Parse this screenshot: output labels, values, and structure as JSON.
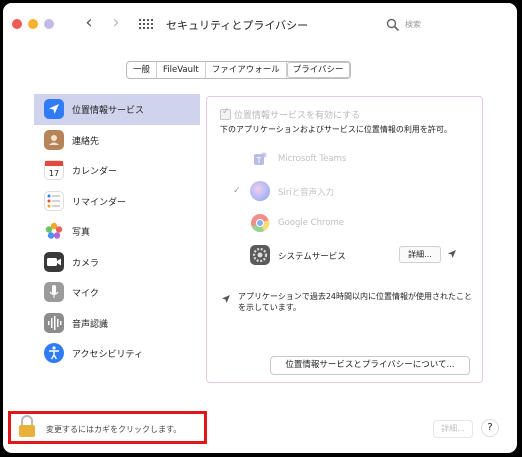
{
  "window": {
    "title": "セキュリティとプライバシー"
  },
  "search": {
    "placeholder": "検索"
  },
  "tabs": [
    "一般",
    "FileVault",
    "ファイアウォール",
    "プライバシー"
  ],
  "sidebar": {
    "items": [
      {
        "label": "位置情報サービス",
        "icon": "location-arrow-icon"
      },
      {
        "label": "連絡先",
        "icon": "contacts-book-icon"
      },
      {
        "label": "カレンダー",
        "icon": "calendar-icon",
        "badge": "17"
      },
      {
        "label": "リマインダー",
        "icon": "reminders-list-icon"
      },
      {
        "label": "写真",
        "icon": "photos-flower-icon"
      },
      {
        "label": "カメラ",
        "icon": "camera-icon"
      },
      {
        "label": "マイク",
        "icon": "microphone-icon"
      },
      {
        "label": "音声認識",
        "icon": "waveform-icon"
      },
      {
        "label": "アクセシビリティ",
        "icon": "accessibility-figure-icon"
      }
    ]
  },
  "main": {
    "enable_label": "位置情報サービスを有効にする",
    "description": "下のアプリケーションおよびサービスに位置情報の利用を許可。",
    "apps": [
      {
        "name": "Microsoft Teams",
        "checked": false,
        "icon": "teams-icon"
      },
      {
        "name": "Siriと音声入力",
        "checked": true,
        "icon": "siri-icon"
      },
      {
        "name": "Google Chrome",
        "checked": false,
        "icon": "chrome-icon"
      },
      {
        "name": "システムサービス",
        "checked": false,
        "icon": "gear-icon",
        "detail_label": "詳細..."
      }
    ],
    "note": "アプリケーションで過去24時間以内に位置情報が使用されたことを示しています。",
    "about_button": "位置情報サービスとプライバシーについて..."
  },
  "footer": {
    "lock_text": "変更するにはカギをクリックします。",
    "advanced_button": "詳細...",
    "help_button": "?"
  },
  "colors": {
    "selection": "#cfd3ec",
    "highlight_box": "#e0161b",
    "panel_border": "#e8c9de"
  }
}
